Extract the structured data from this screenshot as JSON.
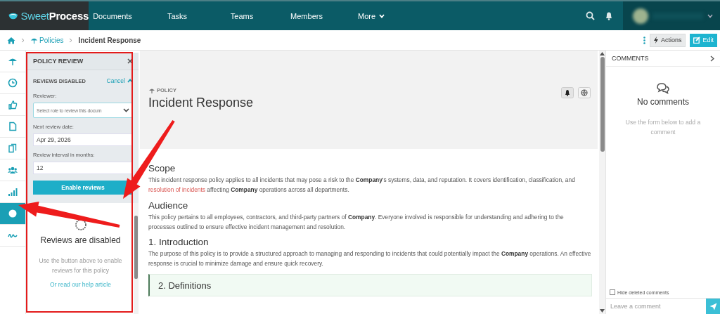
{
  "nav": {
    "logo_light": "Sweet",
    "logo_bold": "Process",
    "items": [
      {
        "label": "Documents",
        "dropdown": false
      },
      {
        "label": "Tasks",
        "dropdown": false
      },
      {
        "label": "Teams",
        "dropdown": false
      },
      {
        "label": "Members",
        "dropdown": false
      },
      {
        "label": "More",
        "dropdown": true
      }
    ]
  },
  "breadcrumb": [
    {
      "label": "Policies",
      "kind": "link"
    },
    {
      "label": "Incident Response",
      "kind": "current"
    }
  ],
  "toolbar": {
    "actions": "Actions",
    "edit": "Edit"
  },
  "sidebar": {
    "items": [
      {
        "kind": "umbrella",
        "selected": false
      },
      {
        "kind": "clock",
        "selected": false
      },
      {
        "kind": "thumbs",
        "selected": false
      },
      {
        "kind": "file",
        "selected": false
      },
      {
        "kind": "files",
        "selected": false
      },
      {
        "kind": "users",
        "selected": false
      },
      {
        "kind": "signal",
        "selected": false
      },
      {
        "kind": "dot",
        "selected": true
      },
      {
        "kind": "signature",
        "selected": false
      }
    ]
  },
  "review_panel": {
    "title": "POLICY REVIEW",
    "status": "REVIEWS DISABLED",
    "cancel": "Cancel",
    "fields": [
      {
        "label": "Reviewer:",
        "kind": "select",
        "placeholder": "Select role to review this docum"
      },
      {
        "label": "Next review date:",
        "kind": "input",
        "value": "Apr 29, 2026"
      },
      {
        "label": "Review interval in months:",
        "kind": "input",
        "value": "12"
      }
    ],
    "button": "Enable reviews",
    "empty_title": "Reviews are disabled",
    "empty_text": "Use the button above to enable reviews for this policy",
    "help_link": "Or read our help article"
  },
  "document": {
    "label": "POLICY",
    "title": "Incident Response",
    "sections": [
      {
        "kind": "heading",
        "text": "Scope"
      },
      {
        "kind": "paragraph",
        "parts": [
          {
            "kind": "text",
            "text": "This incident response policy applies to all incidents that may pose a risk to the **Company**'s systems, data, and reputation. It covers identification, classification, and "
          },
          {
            "kind": "link",
            "text": "resolution of incidents"
          },
          {
            "kind": "text",
            "text": " affecting **Company** operations across all departments."
          }
        ]
      },
      {
        "kind": "heading",
        "text": "Audience"
      },
      {
        "kind": "paragraph",
        "parts": [
          {
            "kind": "text",
            "text": "This policy pertains to all employees, contractors, and third-party partners of **Company**. Everyone involved is responsible for understanding and adhering to the processes outlined to ensure effective incident management and resolution."
          }
        ]
      },
      {
        "kind": "heading",
        "text": "1. Introduction"
      },
      {
        "kind": "paragraph",
        "parts": [
          {
            "kind": "text",
            "text": "The purpose of this policy is to provide a structured approach to managing and responding to incidents that could potentially impact the **Company** operations. An effective response is crucial to minimize damage and ensure quick recovery."
          }
        ]
      },
      {
        "kind": "callout",
        "text": "2. Definitions"
      }
    ]
  },
  "comments": {
    "title": "COMMENTS",
    "empty_title": "No comments",
    "empty_text": "Use the form below to add a comment",
    "hide_deleted": {
      "label": "Hide deleted comments",
      "checked": false
    },
    "placeholder": "Leave a comment"
  },
  "annotations": [
    {
      "kind": "frame"
    },
    {
      "kind": "arrow"
    },
    {
      "kind": "arrow"
    }
  ]
}
